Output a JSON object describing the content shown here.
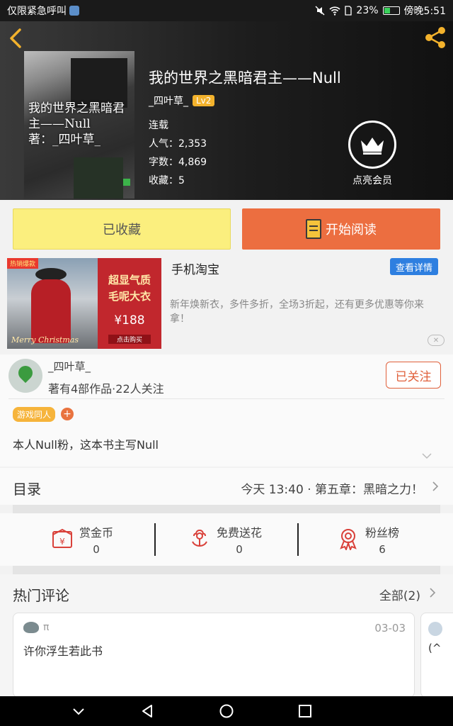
{
  "status_bar": {
    "left_text": "仅限紧急呼叫",
    "battery": "23%",
    "time": "傍晚5:51"
  },
  "book": {
    "cover_title": "我的世界之黑暗君主——Null",
    "cover_author": "著：_四叶草_",
    "title": "我的世界之黑暗君主——Null",
    "author": "_四叶草_",
    "level": "Lv2",
    "status": "连载",
    "popularity": "人气：2,353",
    "word_count": "字数：4,869",
    "favorites": "收藏：5",
    "vip_label": "点亮会员"
  },
  "actions": {
    "collected": "已收藏",
    "start_reading": "开始阅读"
  },
  "ad": {
    "hot_tag": "热销爆款",
    "img_line1": "超显气质",
    "img_line2": "毛呢大衣",
    "price": "¥188",
    "buy": "点击购买",
    "signature": "Merry Christmas",
    "title": "手机淘宝",
    "detail_button": "查看详情",
    "description": "新年焕新衣，多件多折，全场3折起，还有更多优惠等你来拿！",
    "close": "✕"
  },
  "author_card": {
    "name": "_四叶草_",
    "stats": "著有4部作品·22人关注",
    "follow": "已关注",
    "tag": "游戏同人",
    "tag_add": "+",
    "intro": "本人Null粉，这本书主写Null"
  },
  "catalog": {
    "title": "目录",
    "latest": "今天 13:40 · 第五章：黑暗之力！"
  },
  "stats": [
    {
      "label": "赏金币",
      "value": "0",
      "icon": "coin-envelope-icon"
    },
    {
      "label": "免费送花",
      "value": "0",
      "icon": "flower-icon"
    },
    {
      "label": "粉丝榜",
      "value": "6",
      "icon": "medal-icon"
    }
  ],
  "comments": {
    "title": "热门评论",
    "all": "全部(2)",
    "items": [
      {
        "user": "π",
        "date": "03-03",
        "text": "许你浮生若此书"
      },
      {
        "text": "(^"
      }
    ]
  },
  "colors": {
    "accent_orange": "#ec6e40",
    "collected_yellow": "#fbef7e",
    "level_badge": "#f3b22c",
    "detail_blue": "#2e7fe0"
  }
}
